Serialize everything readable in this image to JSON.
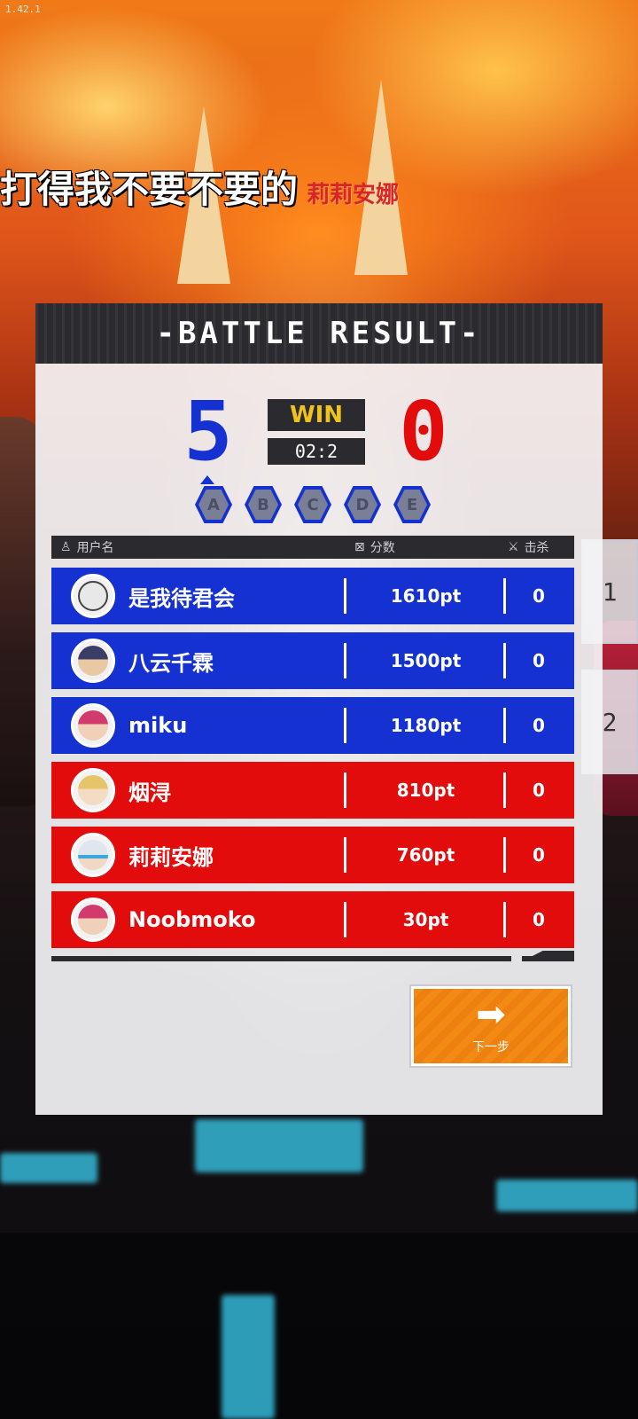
{
  "hud": {
    "version": "1.42.1"
  },
  "danmaku": {
    "text": "打得我不要不要的",
    "user": "莉莉安娜"
  },
  "result": {
    "title": "-BATTLE RESULT-",
    "blue_score": "5",
    "red_score": "0",
    "outcome": "WIN",
    "time": "02:2",
    "grades": [
      "A",
      "B",
      "C",
      "D",
      "E"
    ]
  },
  "table": {
    "col_user": "用户名",
    "col_score": "分数",
    "col_kills": "击杀",
    "rows": [
      {
        "team": "blue",
        "name": "是我待君会",
        "points": "1610pt",
        "kills": "0",
        "avatar": "skull-avatar-icon"
      },
      {
        "team": "blue",
        "name": "八云千霖",
        "points": "1500pt",
        "kills": "0",
        "avatar": "dark-hair-avatar-icon"
      },
      {
        "team": "blue",
        "name": "miku",
        "points": "1180pt",
        "kills": "0",
        "avatar": "pink-hair-avatar-icon"
      },
      {
        "team": "red",
        "name": "烟浔",
        "points": "810pt",
        "kills": "0",
        "avatar": "blonde-avatar-icon"
      },
      {
        "team": "red",
        "name": "莉莉安娜",
        "points": "760pt",
        "kills": "0",
        "avatar": "white-helmet-avatar-icon"
      },
      {
        "team": "red",
        "name": "Noobmoko",
        "points": "30pt",
        "kills": "0",
        "avatar": "pink-hair-avatar-icon"
      }
    ]
  },
  "next_button": {
    "label": "下一步"
  },
  "side_panels": [
    "1",
    "2"
  ],
  "colors": {
    "blue": "#1531d1",
    "red": "#e20c0c",
    "accent": "#f0c21e",
    "button": "#f28a14"
  }
}
